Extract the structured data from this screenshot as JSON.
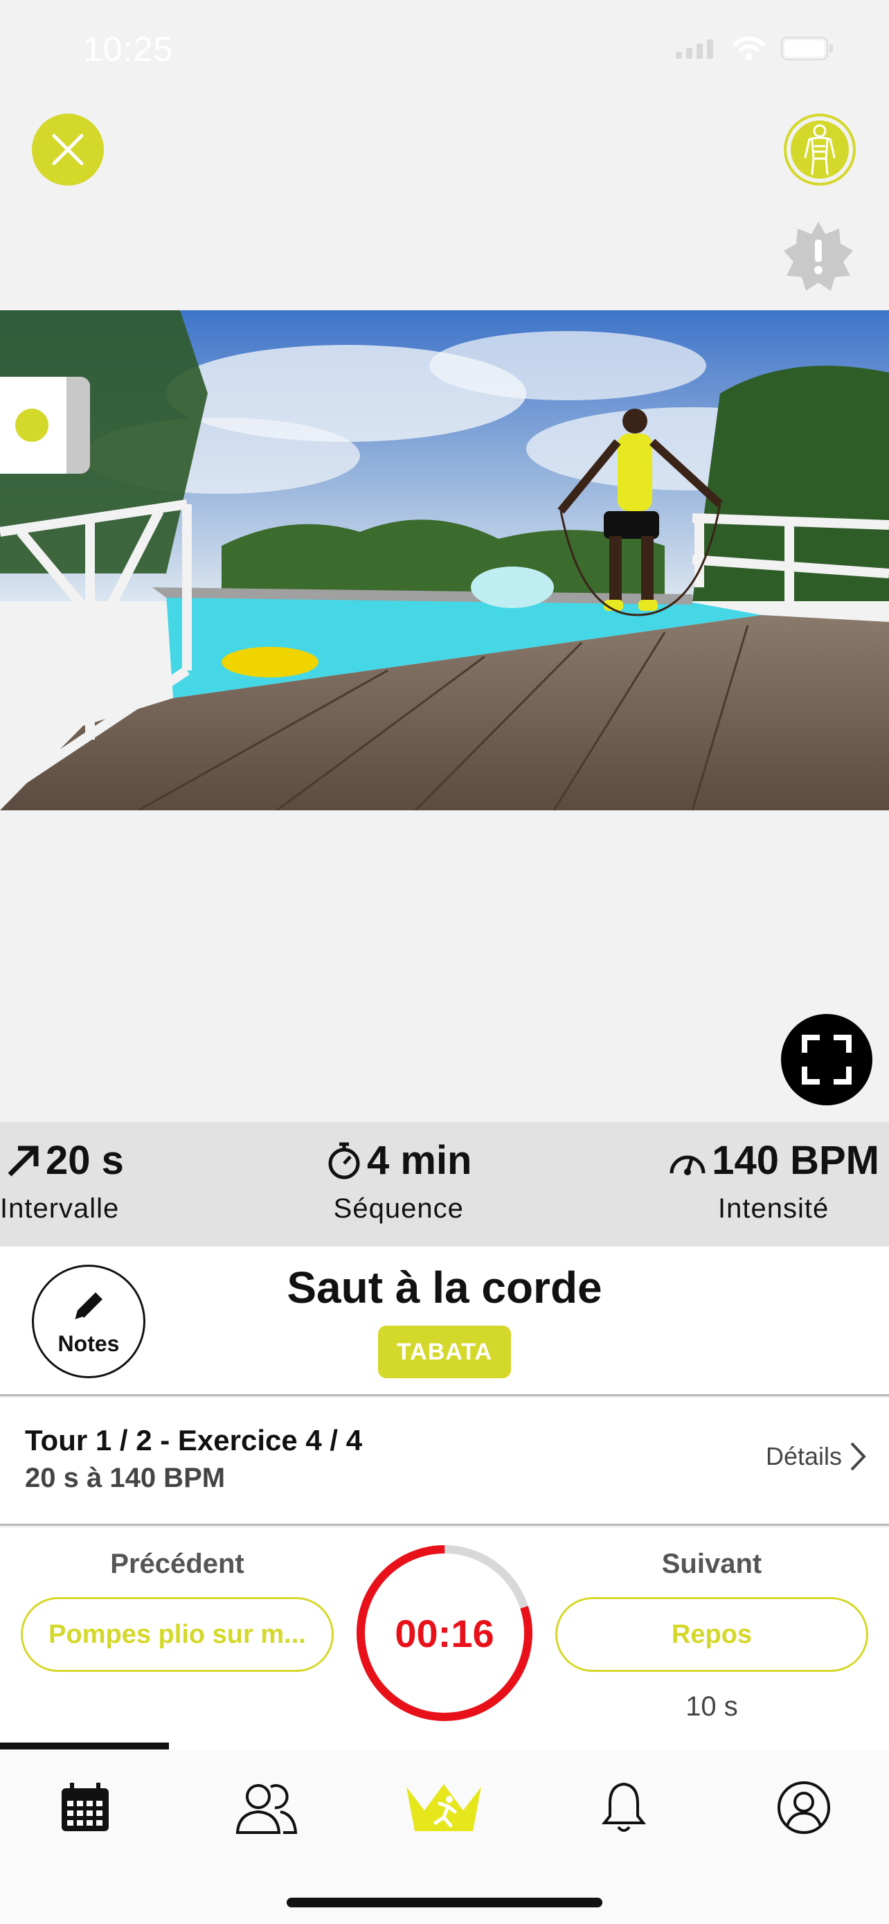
{
  "status_bar": {
    "time": "10:25"
  },
  "top": {
    "close_icon": "close-icon",
    "body_icon": "body-icon",
    "alert_icon": "alert-badge-icon"
  },
  "colors": {
    "accent": "#d4d82a",
    "timer_red": "#e8111a",
    "stats_bg": "#e2e2e2"
  },
  "stats": [
    {
      "icon": "arrow-up-right-icon",
      "value": "20 s",
      "label": "Intervalle"
    },
    {
      "icon": "stopwatch-icon",
      "value": "4 min",
      "label": "Séquence"
    },
    {
      "icon": "gauge-icon",
      "value": "140 BPM",
      "label": "Intensité"
    }
  ],
  "exercise": {
    "notes_label": "Notes",
    "title": "Saut à la corde",
    "badge": "TABATA"
  },
  "tour": {
    "line1": "Tour 1 / 2 - Exercice 4 / 4",
    "line2": "20 s à 140 BPM",
    "details": "Détails"
  },
  "controls": {
    "prev_label": "Précédent",
    "prev_exercise": "Pompes plio sur m...",
    "timer": "00:16",
    "timer_remaining_fraction": 0.8,
    "next_label": "Suivant",
    "next_exercise": "Repos",
    "next_duration": "10 s"
  },
  "progress_fraction": 0.19,
  "tabs": [
    {
      "icon": "calendar-icon"
    },
    {
      "icon": "users-icon"
    },
    {
      "icon": "crown-runner-icon",
      "active": true
    },
    {
      "icon": "bell-icon"
    },
    {
      "icon": "profile-icon"
    }
  ]
}
